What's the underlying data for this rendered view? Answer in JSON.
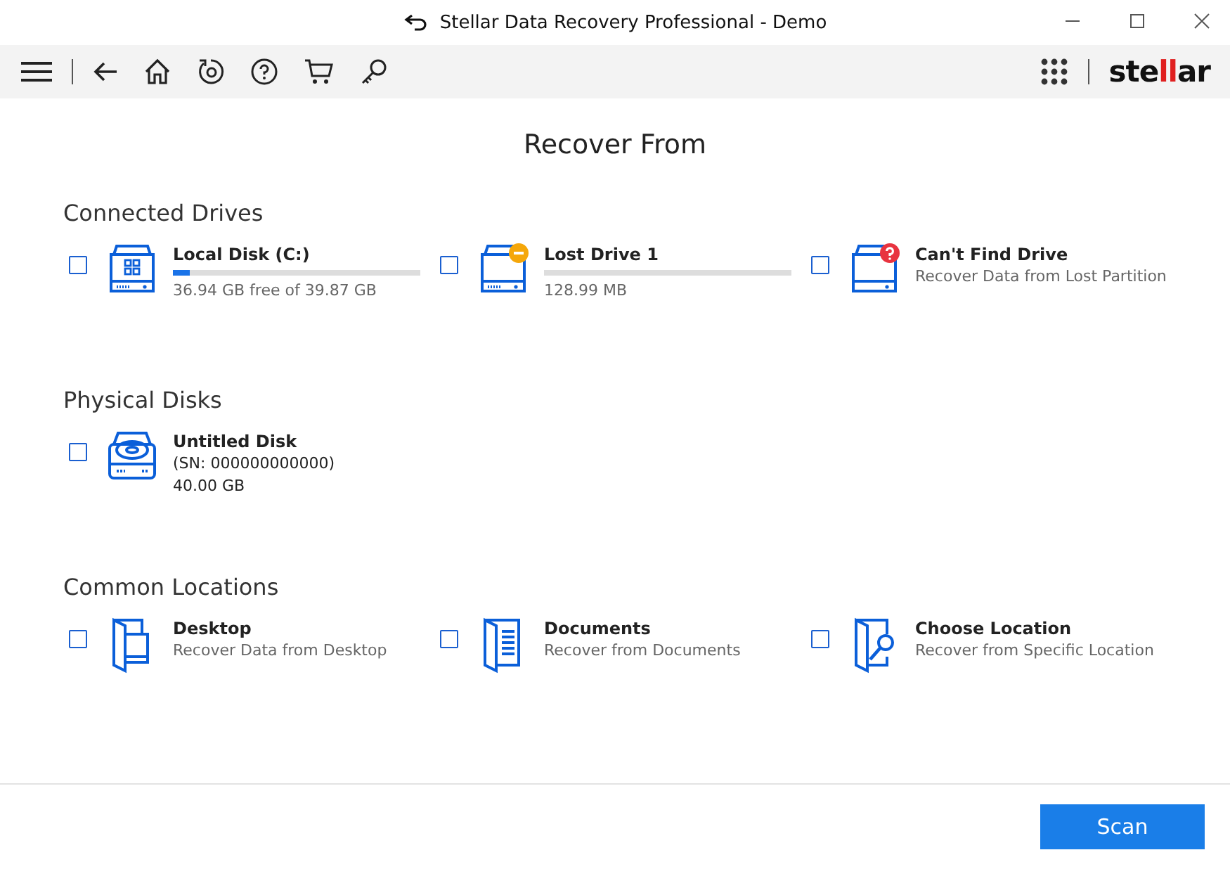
{
  "window": {
    "title": "Stellar Data Recovery Professional - Demo"
  },
  "logo": {
    "text": "stellar"
  },
  "heading": "Recover From",
  "sections": [
    {
      "title": "Connected Drives",
      "items": [
        {
          "kind": "volume",
          "name": "Local Disk (C:)",
          "detail": "36.94 GB free of 39.87 GB",
          "level": 0.07,
          "checked": false
        },
        {
          "kind": "lost",
          "name": "Lost Drive 1",
          "detail": "128.99 MB",
          "level": 0,
          "checked": false
        },
        {
          "kind": "missing",
          "name": "Can't Find Drive",
          "detail": "Recover Data from Lost Partition",
          "checked": false
        }
      ]
    },
    {
      "title": "Physical Disks",
      "items": [
        {
          "kind": "disk",
          "name": "Untitled Disk",
          "detail": "(SN: 000000000000)",
          "extra": "40.00 GB",
          "checked": false
        }
      ]
    },
    {
      "title": "Common Locations",
      "items": [
        {
          "kind": "desktop",
          "name": "Desktop",
          "detail": "Recover Data from Desktop",
          "checked": false
        },
        {
          "kind": "documents",
          "name": "Documents",
          "detail": "Recover from Documents",
          "checked": false
        },
        {
          "kind": "choose",
          "name": "Choose Location",
          "detail": "Recover from Specific Location",
          "checked": false
        }
      ]
    }
  ],
  "scan_button": "Scan"
}
